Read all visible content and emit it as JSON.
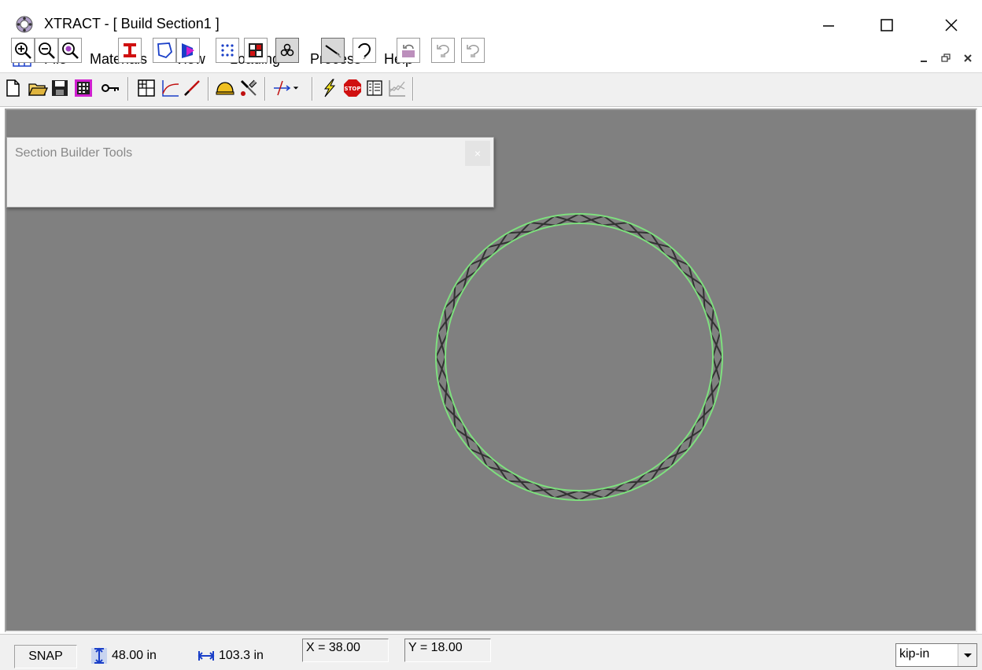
{
  "window": {
    "title": "XTRACT - [ Build Section1 ]"
  },
  "menu": {
    "items": [
      "File",
      "Materials",
      "View",
      "Loading",
      "Process",
      "Help"
    ]
  },
  "toolbar": {
    "buttons": [
      "new-icon",
      "open-icon",
      "save-icon",
      "mesh-icon",
      "key-icon",
      "grid-icon",
      "curve-icon",
      "line-icon",
      "helmet-icon",
      "tools-icon",
      "axis-icon",
      "lightning-icon",
      "stop-icon",
      "report-icon",
      "chart-icon"
    ]
  },
  "palette": {
    "title": "Section Builder Tools",
    "close": "×",
    "buttons": [
      "zoom-in-icon",
      "zoom-out-icon",
      "zoom-fit-icon",
      "i-beam-icon",
      "polygon-icon",
      "shape-fill-icon",
      "points-icon",
      "mesh-square-icon",
      "rebar-icon",
      "line-draw-icon",
      "arc-draw-icon",
      "undo-fill-icon",
      "undo-icon",
      "redo-icon"
    ]
  },
  "status": {
    "snap": "SNAP",
    "height": "48.00 in",
    "width": "103.3 in",
    "x": "X = 38.00",
    "y": "Y = 18.00",
    "units": "kip-in"
  },
  "colors": {
    "canvas": "#808080",
    "section_outline": "#7ee07e",
    "section_hatch": "#333333"
  }
}
